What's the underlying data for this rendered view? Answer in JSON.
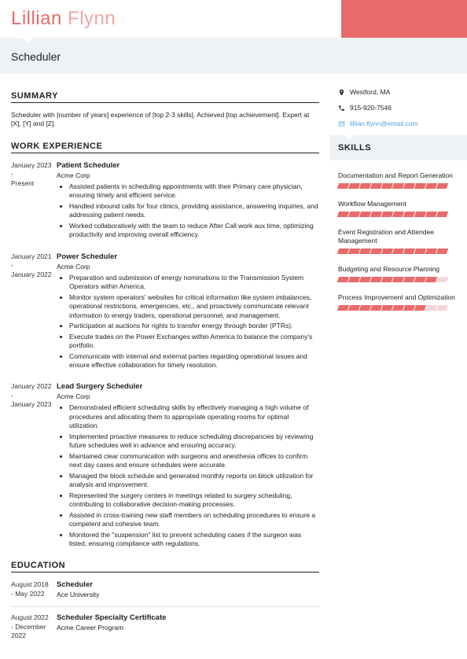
{
  "name": {
    "first": "Lillian",
    "last": "Flynn"
  },
  "role": "Scheduler",
  "sections": {
    "summary": "SUMMARY",
    "work": "WORK EXPERIENCE",
    "education": "EDUCATION",
    "skills": "SKILLS"
  },
  "summary": "Scheduler with [number of years] experience of [top 2-3 skills]. Achieved [top achievement]. Expert at [X], [Y] and [Z].",
  "contact": {
    "location": "Westford, MA",
    "phone": "915-920-7546",
    "email": "lillian.flynn@email.com"
  },
  "work": [
    {
      "start": "January 2023",
      "end": "Present",
      "title": "Patient Scheduler",
      "company": "Acme Corp",
      "bullets": [
        "Assisted patients in scheduling appointments with their Primary care physician, ensuring timely and efficient service.",
        "Handled inbound calls for four clinics, providing assistance, answering inquiries, and addressing patient needs.",
        "Worked collaboratively with the team to reduce After Call work aux time, optimizing productivity and improving overall efficiency."
      ]
    },
    {
      "start": "January 2021",
      "end": "January 2022",
      "title": "Power Scheduler",
      "company": "Acme Corp",
      "bullets": [
        "Preparation and submission of energy nominations to the Transmission System Operators within America.",
        "Monitor system operators' websites for critical information like system imbalances, operational restrictions, emergencies, etc., and proactively communicate relevant information to energy traders, operational personnel, and management.",
        "Participation at auctions for rights to transfer energy through border (PTRs).",
        "Execute trades on the Power Exchanges within America to balance the company's portfolio.",
        "Communicate with internal and external parties regarding operational issues and ensure effective collaboration for timely resolution."
      ]
    },
    {
      "start": "January 2022",
      "end": "January 2023",
      "title": "Lead Surgery Scheduler",
      "company": "Acme Corp",
      "bullets": [
        "Demonstrated efficient scheduling skills by effectively managing a high volume of procedures and allocating them to appropriate operating rooms for optimal utilization.",
        "Implemented proactive measures to reduce scheduling discrepancies by reviewing future schedules well in advance and ensuring accuracy.",
        "Maintained clear communication with surgeons and anesthesia offices to confirm next day cases and ensure schedules were accurate.",
        "Managed the block schedule and generated monthly reports on block utilization for analysis and improvement.",
        "Represented the surgery centers in meetings related to surgery scheduling, contributing to collaborative decision-making processes.",
        "Assisted in cross-training new staff members on scheduling procedures to ensure a competent and cohesive team.",
        "Monitored the \"suspension\" list to prevent scheduling cases if the surgeon was listed, ensuring compliance with regulations."
      ]
    }
  ],
  "education": [
    {
      "start": "August 2018",
      "end": "May 2022",
      "title": "Scheduler",
      "company": "Ace University"
    },
    {
      "start": "August 2022",
      "end": "December 2022",
      "title": "Scheduler Specialty Certificate",
      "company": "Acme Career Program"
    }
  ],
  "skills": [
    {
      "name": "Documentation and Report Generation",
      "level": 10
    },
    {
      "name": "Workflow Management",
      "level": 10
    },
    {
      "name": "Event Registration and Attendee Management",
      "level": 10
    },
    {
      "name": "Budgeting and Resource Planning",
      "level": 9
    },
    {
      "name": "Process Improvement and Optimization",
      "level": 8
    }
  ],
  "skill_max": 10
}
